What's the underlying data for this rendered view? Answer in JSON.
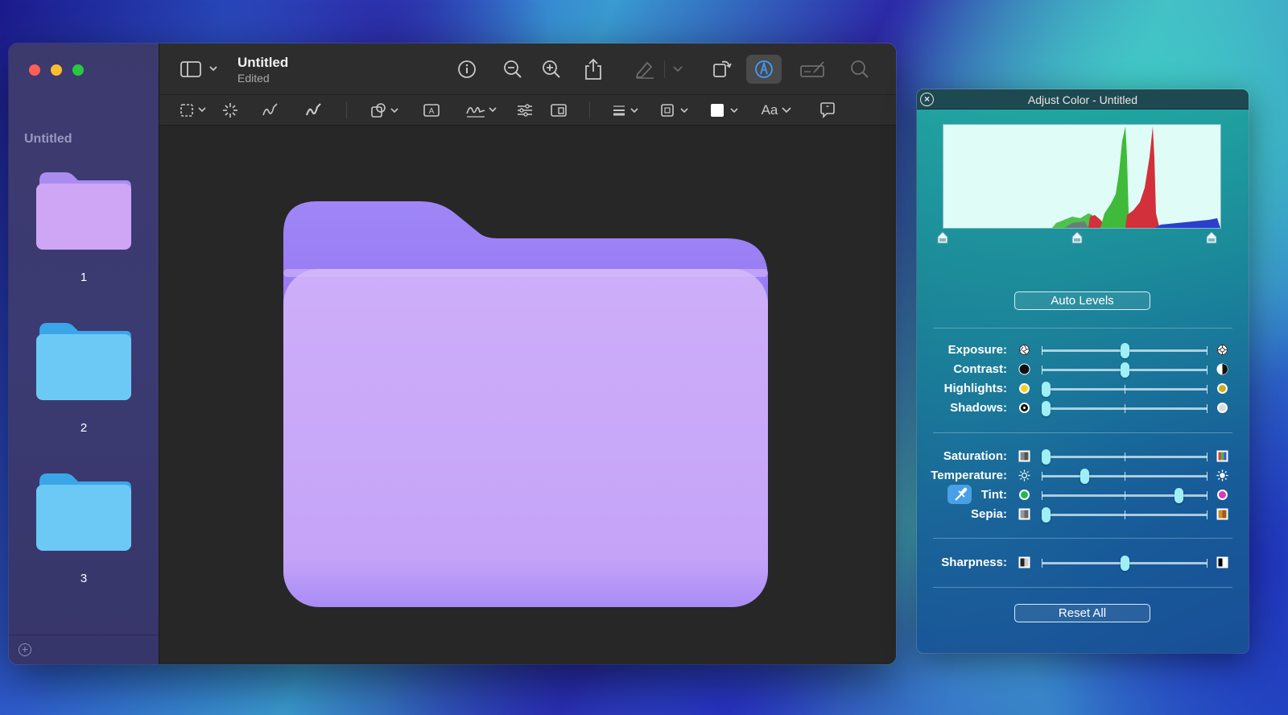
{
  "window": {
    "title": "Untitled",
    "subtitle": "Edited"
  },
  "sidebar": {
    "title": "Untitled",
    "pages": [
      {
        "label": "1",
        "color": "#c9a5f5"
      },
      {
        "label": "2",
        "color": "#66c7f4"
      },
      {
        "label": "3",
        "color": "#66c7f4"
      }
    ]
  },
  "toolbar": {
    "top_icons": [
      "sidebar-toggle-icon",
      "info-icon",
      "zoom-out-icon",
      "zoom-in-icon",
      "share-icon",
      "highlight-pen-icon",
      "rotate-icon",
      "markup-icon",
      "form-fill-icon",
      "search-icon"
    ],
    "markup_icons": [
      "rectangular-selection-icon",
      "instant-alpha-icon",
      "sketch-icon",
      "draw-icon",
      "shapes-icon",
      "text-box-icon",
      "signature-icon",
      "adjust-color-icon",
      "page-layout-icon",
      "line-style-icon",
      "border-color-icon",
      "fill-color-icon",
      "text-style-icon",
      "speech-bubble-icon"
    ],
    "text_style_label": "Aa"
  },
  "document": {
    "folder_color": "#c9a5f5",
    "folder_tab_color": "#9a84f3"
  },
  "adjust_color": {
    "title": "Adjust Color - Untitled",
    "auto_levels": "Auto Levels",
    "reset_all": "Reset All",
    "levels": {
      "black": 0,
      "mid": 0.5,
      "white": 1
    },
    "group1": [
      {
        "label": "Exposure:",
        "value": 0.5
      },
      {
        "label": "Contrast:",
        "value": 0.5
      },
      {
        "label": "Highlights:",
        "value": 0.0
      },
      {
        "label": "Shadows:",
        "value": 0.0
      }
    ],
    "group2": [
      {
        "label": "Saturation:",
        "value": 0.0
      },
      {
        "label": "Temperature:",
        "value": 0.26
      },
      {
        "label": "Tint:",
        "value": 0.83
      },
      {
        "label": "Sepia:",
        "value": 0.0
      }
    ],
    "group3": [
      {
        "label": "Sharpness:",
        "value": 0.5
      }
    ]
  },
  "colors": {
    "accent": "#3f9bff",
    "histogram_bg": "#dffcf6",
    "histogram_red": "#d2303a",
    "histogram_green": "#3fba3a",
    "histogram_blue": "#2a3fcc"
  }
}
